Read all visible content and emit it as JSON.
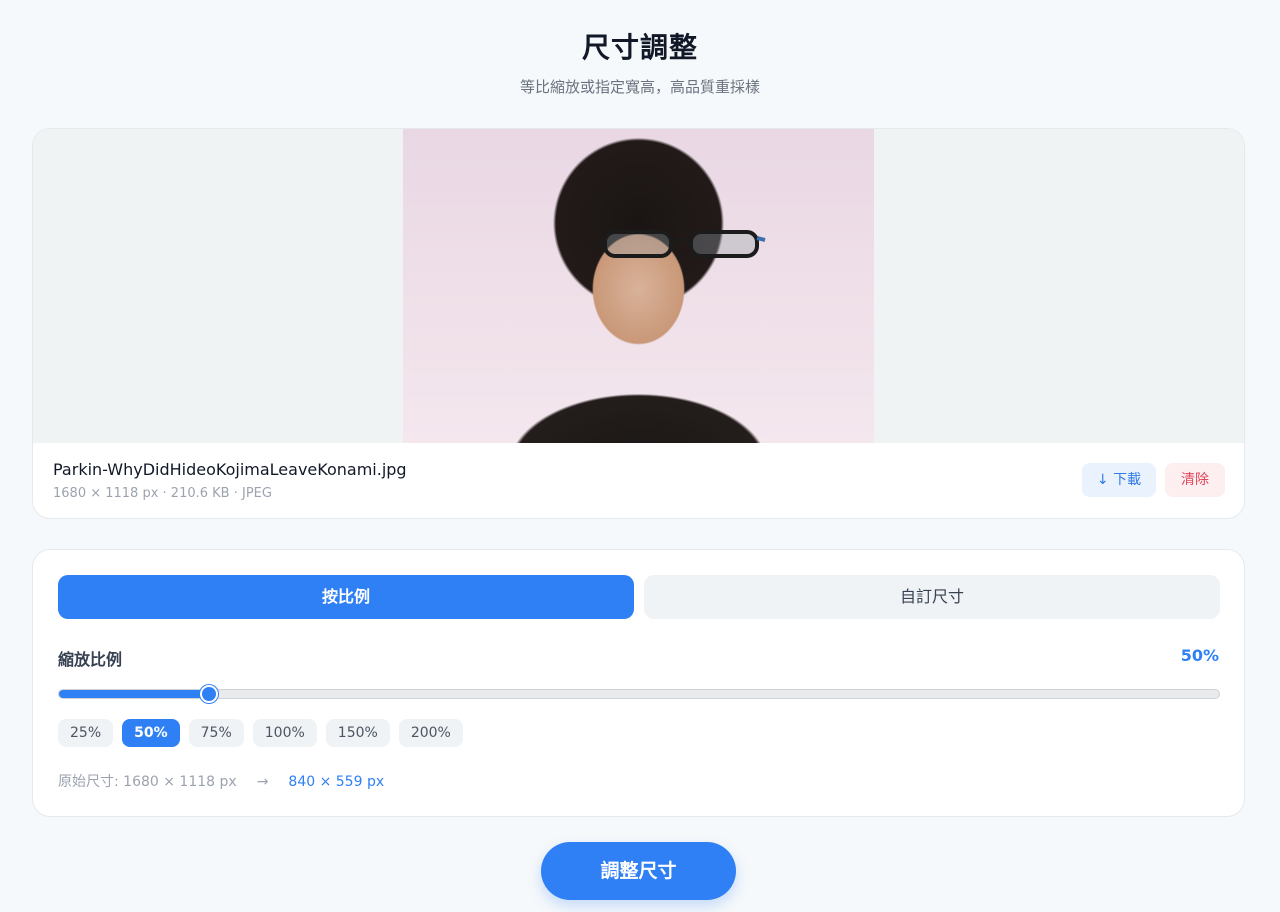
{
  "header": {
    "title": "尺寸調整",
    "subtitle": "等比縮放或指定寬高，高品質重採樣"
  },
  "file": {
    "name": "Parkin-WhyDidHideoKojimaLeaveKonami.jpg",
    "meta": "1680 × 1118 px · 210.6 KB · JPEG",
    "download_label": "↓ 下載",
    "clear_label": "清除"
  },
  "mode_tabs": {
    "ratio_label": "按比例",
    "custom_label": "自訂尺寸",
    "active": "ratio"
  },
  "scale": {
    "label": "縮放比例",
    "value_text": "50%",
    "slider_fraction": 0.129,
    "presets": [
      "25%",
      "50%",
      "75%",
      "100%",
      "150%",
      "200%"
    ],
    "active_preset": "50%"
  },
  "size": {
    "original": "原始尺寸: 1680 × 1118 px",
    "arrow": "→",
    "target": "840 × 559 px"
  },
  "actions": {
    "resize_label": "調整尺寸"
  },
  "colors": {
    "accent": "#2f80f5",
    "danger": "#e0475b",
    "background": "#f6f9fb"
  }
}
